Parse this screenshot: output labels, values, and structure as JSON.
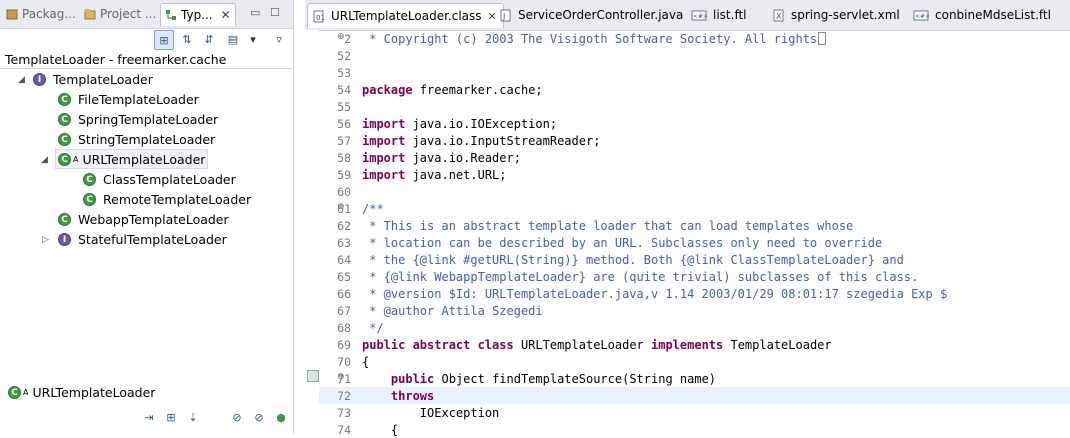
{
  "left_panel": {
    "tabs": [
      {
        "label": "Packag...",
        "icon": "package-explorer-icon"
      },
      {
        "label": "Project ...",
        "icon": "project-explorer-icon"
      },
      {
        "label": "Typ...",
        "icon": "type-hierarchy-icon"
      }
    ],
    "hierarchy_title": "TemplateLoader - freemarker.cache",
    "tree": [
      {
        "label": "TemplateLoader",
        "kind": "interface",
        "level": 0,
        "expanded": true
      },
      {
        "label": "FileTemplateLoader",
        "kind": "class",
        "level": 1
      },
      {
        "label": "SpringTemplateLoader",
        "kind": "class",
        "level": 1
      },
      {
        "label": "StringTemplateLoader",
        "kind": "class",
        "level": 1
      },
      {
        "label": "URLTemplateLoader",
        "kind": "abstract-class",
        "level": 1,
        "expanded": true,
        "selected": true
      },
      {
        "label": "ClassTemplateLoader",
        "kind": "class",
        "level": 2
      },
      {
        "label": "RemoteTemplateLoader",
        "kind": "class",
        "level": 2
      },
      {
        "label": "WebappTemplateLoader",
        "kind": "class",
        "level": 1
      },
      {
        "label": "StatefulTemplateLoader",
        "kind": "interface",
        "level": 1,
        "collapsed": true
      }
    ],
    "selected_type": "URLTemplateLoader",
    "abstract_marker": "A"
  },
  "editor_tabs": [
    {
      "label": "URLTemplateLoader.class",
      "icon": "class-file-icon",
      "active": true
    },
    {
      "label": "ServiceOrderController.java",
      "icon": "java-file-icon"
    },
    {
      "label": "list.ftl",
      "icon": "ftl-file-icon"
    },
    {
      "label": "spring-servlet.xml",
      "icon": "xml-file-icon"
    },
    {
      "label": "conbineMdseList.ftl",
      "icon": "ftl-file-icon"
    }
  ],
  "code_lines": [
    {
      "n": "2",
      "text": " * Copyright (c) 2003 The Visigoth Software Society. All rights"
    },
    {
      "n": "52",
      "text": ""
    },
    {
      "n": "53",
      "text": ""
    },
    {
      "n": "54",
      "text": "package freemarker.cache;"
    },
    {
      "n": "55",
      "text": ""
    },
    {
      "n": "56",
      "text": "import java.io.IOException;"
    },
    {
      "n": "57",
      "text": "import java.io.InputStreamReader;"
    },
    {
      "n": "58",
      "text": "import java.io.Reader;"
    },
    {
      "n": "59",
      "text": "import java.net.URL;"
    },
    {
      "n": "60",
      "text": ""
    },
    {
      "n": "61",
      "text": "/**"
    },
    {
      "n": "62",
      "text": " * This is an abstract template loader that can load templates whose"
    },
    {
      "n": "63",
      "text": " * location can be described by an URL. Subclasses only need to override"
    },
    {
      "n": "64",
      "text": " * the {@link #getURL(String)} method. Both {@link ClassTemplateLoader} and"
    },
    {
      "n": "65",
      "text": " * {@link WebappTemplateLoader} are (quite trivial) subclasses of this class."
    },
    {
      "n": "66",
      "text": " * @version $Id: URLTemplateLoader.java,v 1.14 2003/01/29 08:01:17 szegedia Exp $"
    },
    {
      "n": "67",
      "text": " * @author Attila Szegedi"
    },
    {
      "n": "68",
      "text": " */"
    },
    {
      "n": "69",
      "text": "public abstract class URLTemplateLoader implements TemplateLoader"
    },
    {
      "n": "70",
      "text": "{"
    },
    {
      "n": "71",
      "text": "    public Object findTemplateSource(String name)"
    },
    {
      "n": "72",
      "text": "    throws"
    },
    {
      "n": "73",
      "text": "        IOException"
    },
    {
      "n": "74",
      "text": "    {"
    }
  ]
}
